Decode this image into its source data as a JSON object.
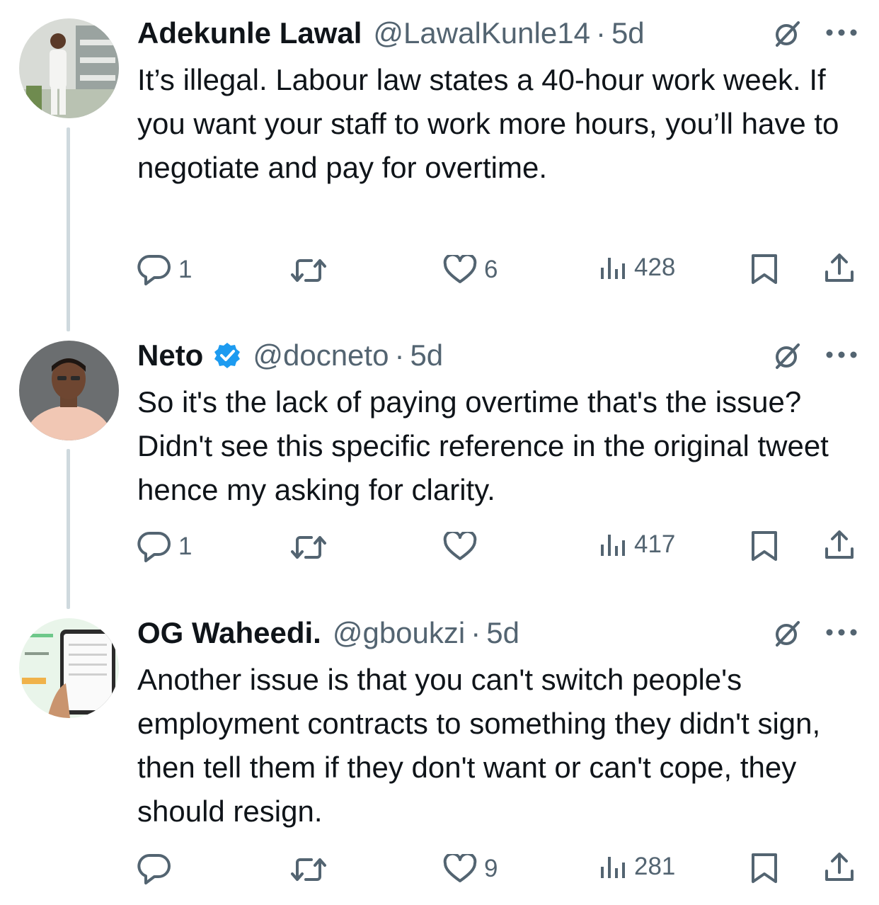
{
  "tweets": [
    {
      "name": "Adekunle Lawal",
      "handle": "@LawalKunle14",
      "time": "5d",
      "text": "It’s illegal. Labour law states a 40-hour work week. If you want your staff to work more hours, you’ll have to negotiate and pay for overtime.",
      "replies": "1",
      "reposts": "",
      "likes": "6",
      "views": "428",
      "verified": false
    },
    {
      "name": "Neto",
      "handle": "@docneto",
      "time": "5d",
      "text": "So it's the lack of paying overtime that's the issue? Didn't see this specific reference in the original tweet hence my asking for clarity.",
      "replies": "1",
      "reposts": "",
      "likes": "",
      "views": "417",
      "verified": true
    },
    {
      "name": "OG Waheedi.",
      "handle": "@gboukzi",
      "time": "5d",
      "text": "Another issue is that you can't switch people's employment contracts to something they didn't sign, then tell them if they don't want or can't cope, they should resign.",
      "replies": "",
      "reposts": "",
      "likes": "9",
      "views": "281",
      "verified": false
    }
  ],
  "colors": {
    "text_primary": "#0f1419",
    "text_secondary": "#536471",
    "verified_blue": "#1d9bf0",
    "thread_line": "#cfd9de"
  },
  "icons": [
    "reply-icon",
    "repost-icon",
    "like-icon",
    "views-icon",
    "bookmark-icon",
    "share-icon",
    "grok-icon",
    "more-icon",
    "verified-badge-icon"
  ],
  "separator": "·"
}
